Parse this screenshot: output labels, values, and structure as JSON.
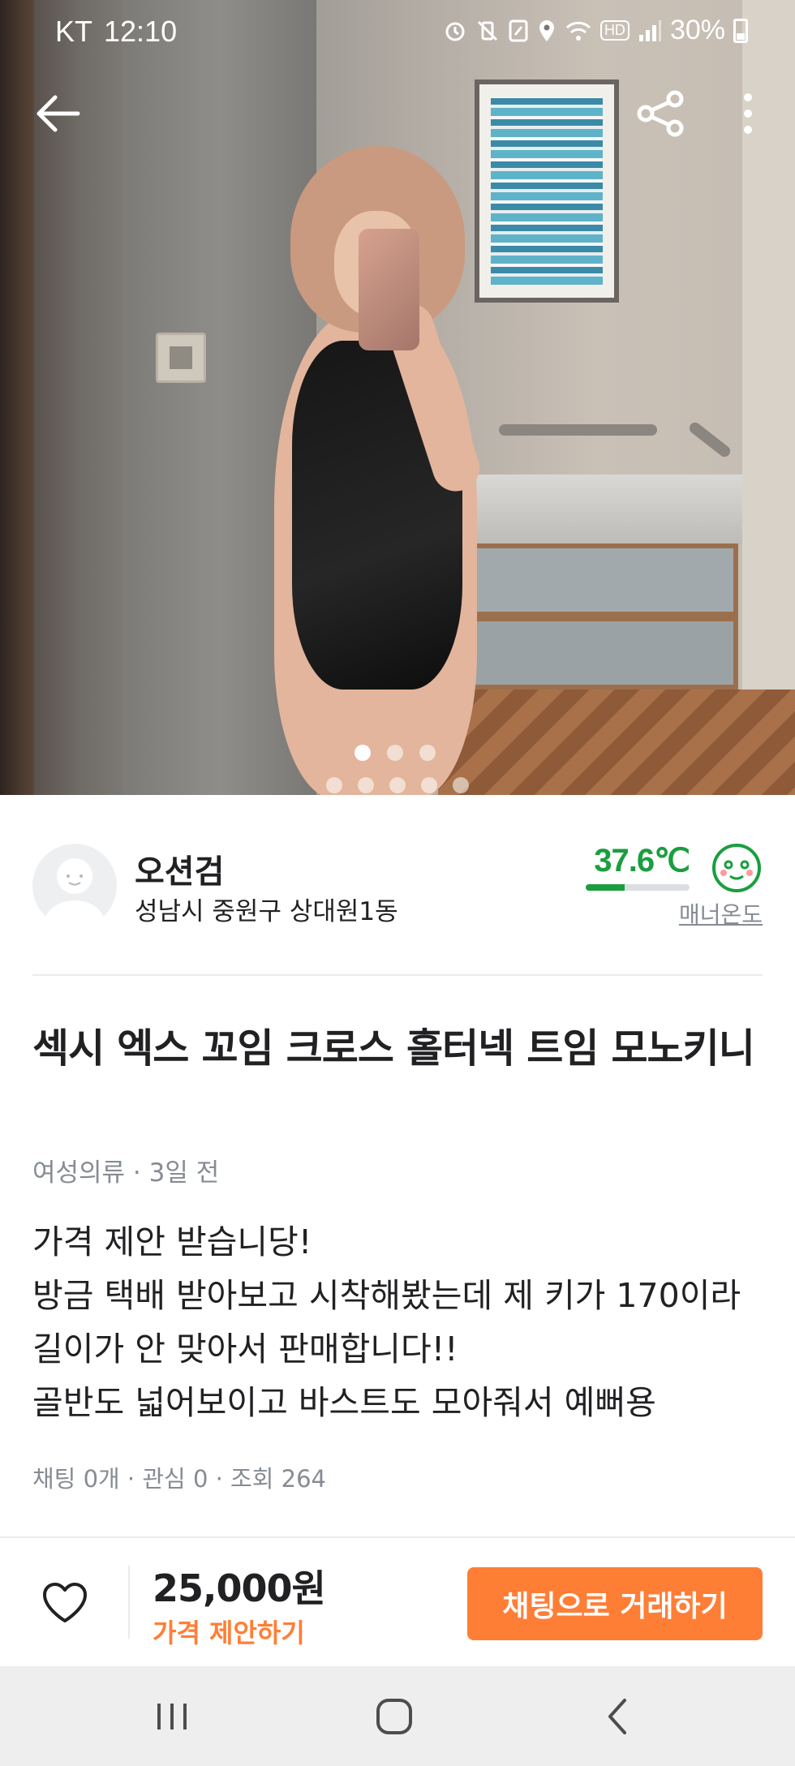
{
  "status_bar": {
    "carrier": "KT",
    "time": "12:10",
    "icons": [
      "alarm-icon",
      "vibrate-icon",
      "nfc-icon",
      "location-icon",
      "wifi-icon",
      "hd-icon",
      "signal-icon"
    ],
    "hd_label": "HD",
    "battery": "30%"
  },
  "top_nav": {
    "back_icon": "arrow-left-icon",
    "share_icon": "share-icon",
    "more_icon": "more-vertical-icon"
  },
  "photo": {
    "page_index": 1,
    "page_count": 3,
    "strip_count": 5
  },
  "seller": {
    "name": "오션검",
    "location": "성남시 중원구 상대원1동",
    "temperature": "37.6℃",
    "temperature_value": 37.6,
    "manner_label": "매너온도",
    "colors": {
      "temperature": "#1a9e3f"
    }
  },
  "article": {
    "title": "섹시 엑스 꼬임 크로스 홀터넥 트임 모노키니",
    "meta": "여성의류 · 3일 전",
    "description": "가격 제안 받습니당!\n방금 택배 받아보고 시착해봤는데 제 키가 170이라\n길이가 안 맞아서 판매합니다!!\n골반도 넓어보이고 바스트도 모아줘서 예뻐용",
    "stats": "채팅 0개 · 관심 0 · 조회 264"
  },
  "action_bar": {
    "price": "25,000원",
    "offer_label": "가격 제안하기",
    "chat_button": "채팅으로 거래하기",
    "colors": {
      "accent": "#ff7e36"
    }
  },
  "system_nav": {
    "recent_icon": "recent-apps-icon",
    "home_icon": "home-icon",
    "back_icon": "back-chevron-icon"
  }
}
